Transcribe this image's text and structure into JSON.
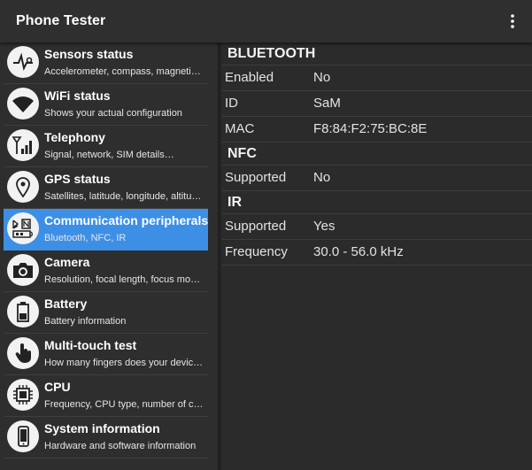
{
  "app": {
    "title": "Phone Tester"
  },
  "sidebar": {
    "items": [
      {
        "title": "Sensors status",
        "subtitle": "Accelerometer, compass, magnetic fie",
        "icon": "sensor-pulse-icon"
      },
      {
        "title": "WiFi status",
        "subtitle": "Shows your actual configuration",
        "icon": "wifi-icon"
      },
      {
        "title": "Telephony",
        "subtitle": "Signal, network, SIM details…",
        "icon": "cell-tower-icon"
      },
      {
        "title": "GPS status",
        "subtitle": "Satellites, latitude, longitude, altitude…",
        "icon": "location-pin-icon"
      },
      {
        "title": "Communication peripherals",
        "subtitle": "Bluetooth, NFC, IR",
        "icon": "bluetooth-nfc-ir-icon",
        "selected": true
      },
      {
        "title": "Camera",
        "subtitle": "Resolution, focal length, focus mode…",
        "icon": "camera-icon"
      },
      {
        "title": "Battery",
        "subtitle": "Battery information",
        "icon": "battery-icon"
      },
      {
        "title": "Multi-touch test",
        "subtitle": "How many fingers does your device r…",
        "icon": "touch-hand-icon"
      },
      {
        "title": "CPU",
        "subtitle": "Frequency, CPU type, number of core…",
        "icon": "cpu-chip-icon"
      },
      {
        "title": "System information",
        "subtitle": "Hardware and software information",
        "icon": "phone-icon"
      }
    ]
  },
  "content": {
    "sections": [
      {
        "header": "BLUETOOTH",
        "rows": [
          {
            "key": "Enabled",
            "value": "No"
          },
          {
            "key": "ID",
            "value": "SaM"
          },
          {
            "key": "MAC",
            "value": "F8:84:F2:75:BC:8E"
          }
        ]
      },
      {
        "header": "NFC",
        "rows": [
          {
            "key": "Supported",
            "value": "No"
          }
        ]
      },
      {
        "header": "IR",
        "rows": [
          {
            "key": "Supported",
            "value": "Yes"
          },
          {
            "key": "Frequency",
            "value": "30.0 - 56.0 kHz"
          }
        ]
      }
    ]
  },
  "colors": {
    "background": "#2b2b2b",
    "appbar": "#2f2f2f",
    "selected": "#3d8fe6",
    "icon_bg": "#f2f2f2"
  }
}
